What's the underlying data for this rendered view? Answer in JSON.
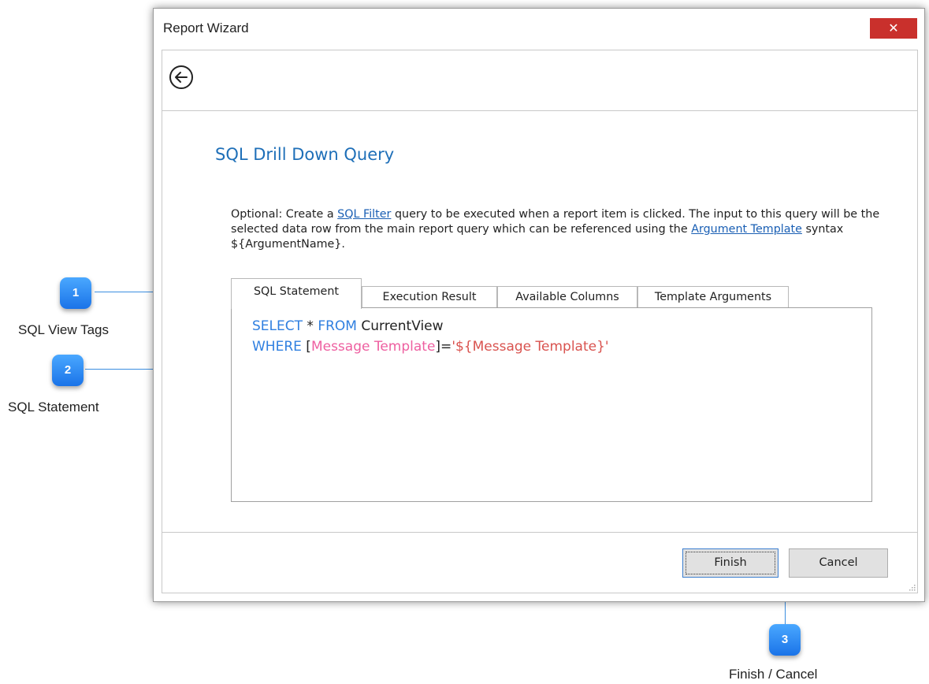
{
  "window": {
    "title": "Report Wizard",
    "close_label": "✕"
  },
  "page": {
    "heading": "SQL Drill Down Query",
    "description": {
      "part1": "Optional: Create a ",
      "link1": "SQL Filter",
      "part2": " query to be executed when a report item is clicked.  The input to this query will be the selected data row from the main report query which can be referenced using the ",
      "link2": "Argument Template",
      "part3": " syntax ${ArgumentName}."
    }
  },
  "tabs": [
    {
      "label": "SQL Statement",
      "active": true
    },
    {
      "label": "Execution Result",
      "active": false
    },
    {
      "label": "Available Columns",
      "active": false
    },
    {
      "label": "Template Arguments",
      "active": false
    }
  ],
  "editor": {
    "line1": {
      "kw1": "SELECT",
      "plain1": " * ",
      "kw2": "FROM",
      "plain2": " CurrentView"
    },
    "line2": {
      "kw1": "WHERE",
      "plain1": " [",
      "ident": "Message Template",
      "plain2": "]=",
      "str": "'${Message Template}'"
    }
  },
  "buttons": {
    "finish": "Finish",
    "cancel": "Cancel"
  },
  "callouts": [
    {
      "number": "1",
      "label": "SQL View Tags"
    },
    {
      "number": "2",
      "label": "SQL Statement"
    },
    {
      "number": "3",
      "label": "Finish / Cancel"
    }
  ],
  "colors": {
    "accent": "#1e6fb8",
    "keyword": "#2f7fe0",
    "identifier": "#ee5fa0",
    "string": "#d9534f",
    "close": "#c9302c",
    "badge": "#1a73e8"
  },
  "icons": {
    "back": "arrow-left-circle-icon",
    "close": "close-icon",
    "grip": "resize-grip-icon"
  }
}
